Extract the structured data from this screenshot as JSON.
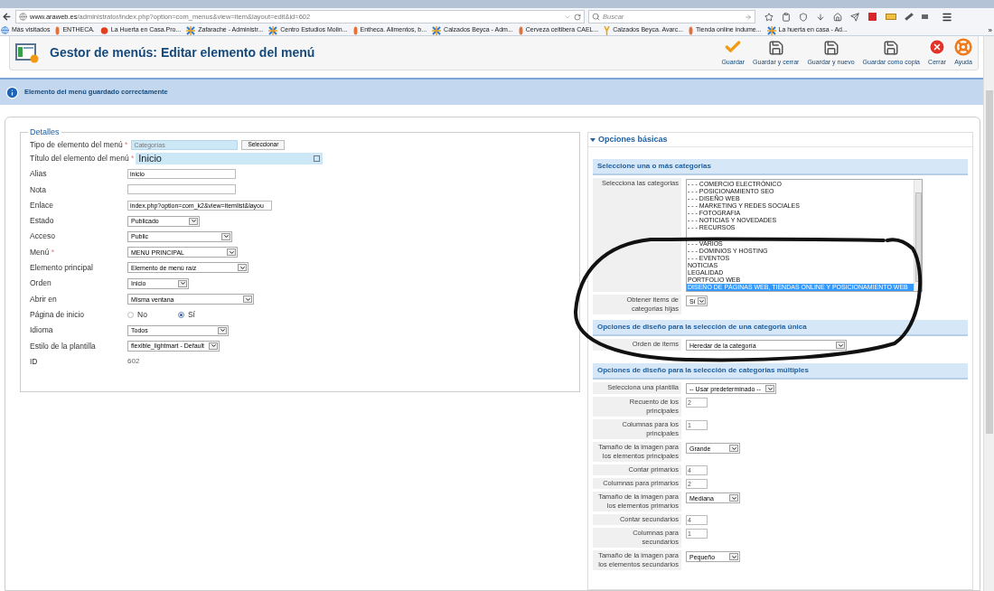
{
  "browser": {
    "url_host": "www.araweb.es",
    "url_path": "/administrator/index.php?option=com_menus&view=item&layout=edit&id=602",
    "search_placeholder": "Buscar",
    "bookmarks": [
      {
        "label": "Más visitados",
        "kind": "globe"
      },
      {
        "label": "ENTHECA.",
        "kind": "drop"
      },
      {
        "label": "La Huerta en Casa.Pro...",
        "kind": "fruit"
      },
      {
        "label": "Zafarache - Administr...",
        "kind": "joomla"
      },
      {
        "label": "Centro Estudios Molin...",
        "kind": "joomla"
      },
      {
        "label": "Entheca. Alimentos, b...",
        "kind": "drop"
      },
      {
        "label": "Calzados Beyca - Adm...",
        "kind": "joomla"
      },
      {
        "label": "Cerveza celtibera CAEL...",
        "kind": "drop"
      },
      {
        "label": "Calzados Beyca. Avarc...",
        "kind": "fork"
      },
      {
        "label": "Tienda online indume...",
        "kind": "drop"
      },
      {
        "label": "La huerta en casa - Ad...",
        "kind": "joomla"
      }
    ],
    "overflow": "»"
  },
  "header": {
    "title": "Gestor de menús: Editar elemento del menú",
    "actions": [
      {
        "label": "Guardar",
        "kind": "check"
      },
      {
        "label": "Guardar y cerrar",
        "kind": "save"
      },
      {
        "label": "Guardar y nuevo",
        "kind": "save"
      },
      {
        "label": "Guardar como copia",
        "kind": "save"
      },
      {
        "label": "Cerrar",
        "kind": "close"
      },
      {
        "label": "Ayuda",
        "kind": "help"
      }
    ]
  },
  "message": "Elemento del menú guardado correctamente",
  "details": {
    "legend": "Detalles",
    "fields": [
      {
        "kind": "type",
        "label": "Tipo de elemento del menú",
        "required_mark": "*",
        "value": "Categorías",
        "button": "Seleccionar"
      },
      {
        "kind": "title",
        "label": "Título del elemento del menú",
        "required_mark": "*",
        "value": "Inicio"
      },
      {
        "kind": "text",
        "label": "Alias",
        "value": "inicio"
      },
      {
        "kind": "text",
        "label": "Nota"
      },
      {
        "kind": "text",
        "label": "Enlace",
        "value": "index.php?option=com_k2&view=itemlist&layou"
      },
      {
        "kind": "select",
        "label": "Estado",
        "value": "Publicado"
      },
      {
        "kind": "select",
        "label": "Acceso",
        "value": "Public"
      },
      {
        "kind": "select",
        "label": "Menú",
        "required_mark": "*",
        "value": "MENU PRINCIPAL"
      },
      {
        "kind": "select",
        "label": "Elemento principal",
        "value": "Elemento de menú raíz"
      },
      {
        "kind": "select",
        "label": "Orden",
        "value": "Inicio"
      },
      {
        "kind": "select",
        "label": "Abrir en",
        "value": "Misma ventana"
      },
      {
        "kind": "radio",
        "label": "Página de inicio",
        "options": [
          {
            "label": "No",
            "selected": false
          },
          {
            "label": "Sí",
            "selected": true
          }
        ]
      },
      {
        "kind": "select",
        "label": "Idioma",
        "value": "Todos"
      },
      {
        "kind": "select",
        "label": "Estilo de la plantilla",
        "value": "flexible_lightmart - Default"
      },
      {
        "kind": "static",
        "label": "ID",
        "value": "602"
      }
    ]
  },
  "basic_options": {
    "title": "Opciones básicas",
    "expanded": true,
    "sections": [
      {
        "title": "Seleccione una o más categorias",
        "rows": [
          {
            "kind": "listbox",
            "label": "Selecciona las categorias",
            "items": [
              {
                "label": "- - - COMERCIO ELECTRÓNICO",
                "selected": false
              },
              {
                "label": "- - - POSICIONAMIENTO SEO",
                "selected": false
              },
              {
                "label": "- - - DISEÑO WEB",
                "selected": false
              },
              {
                "label": "- - - MARKETING Y REDES SOCIALES",
                "selected": false
              },
              {
                "label": "- - - FOTOGRAFIA",
                "selected": false
              },
              {
                "label": "- - - NOTICIAS Y NOVEDADES",
                "selected": false
              },
              {
                "label": "- - - RECURSOS",
                "selected": false
              },
              {
                "kind": "hidden"
              },
              {
                "label": "- - - VARIOS",
                "selected": false
              },
              {
                "label": "- - - DOMINIOS Y HOSTING",
                "selected": false
              },
              {
                "label": "- - - EVENTOS",
                "selected": false
              },
              {
                "label": "NOTICIAS",
                "selected": false
              },
              {
                "label": "LEGALIDAD",
                "selected": false
              },
              {
                "label": "PORTFOLIO WEB",
                "selected": false
              },
              {
                "label": "DISEÑO DE PÁGINAS WEB, TIENDAS ONLINE Y POSICIONAMIENTO WEB",
                "selected": true
              }
            ]
          },
          {
            "kind": "select",
            "label": "Obtener items de categorias hijas",
            "value": "Sí"
          }
        ]
      },
      {
        "title": "Opciones de diseño para la selección de una categoria única",
        "rows": [
          {
            "kind": "select",
            "label": "Orden de items",
            "value": "Heredar de la categoría"
          }
        ]
      },
      {
        "title": "Opciones de diseño para la selección de categorias múltiples",
        "rows": [
          {
            "kind": "select",
            "label": "Selecciona una plantilla",
            "value": "-- Usar predeterminado --"
          },
          {
            "kind": "text",
            "label": "Recuento de los principales",
            "value": "2"
          },
          {
            "kind": "text",
            "label": "Columnas para los principales",
            "value": "1"
          },
          {
            "kind": "select",
            "label": "Tamaño de la imagen para los elementos principales",
            "value": "Grande"
          },
          {
            "kind": "text",
            "label": "Contar primarios",
            "value": "4"
          },
          {
            "kind": "text",
            "label": "Columnas para primarios",
            "value": "2"
          },
          {
            "kind": "select",
            "label": "Tamaño de la imagen para los elementos primarios",
            "value": "Mediana"
          },
          {
            "kind": "text",
            "label": "Contar secundarios",
            "value": "4"
          },
          {
            "kind": "text",
            "label": "Columnas para secundarios",
            "value": "1"
          },
          {
            "kind": "select",
            "label": "Tamaño de la imagen para los elementos secundarios",
            "value": "Pequeño"
          }
        ]
      }
    ]
  }
}
